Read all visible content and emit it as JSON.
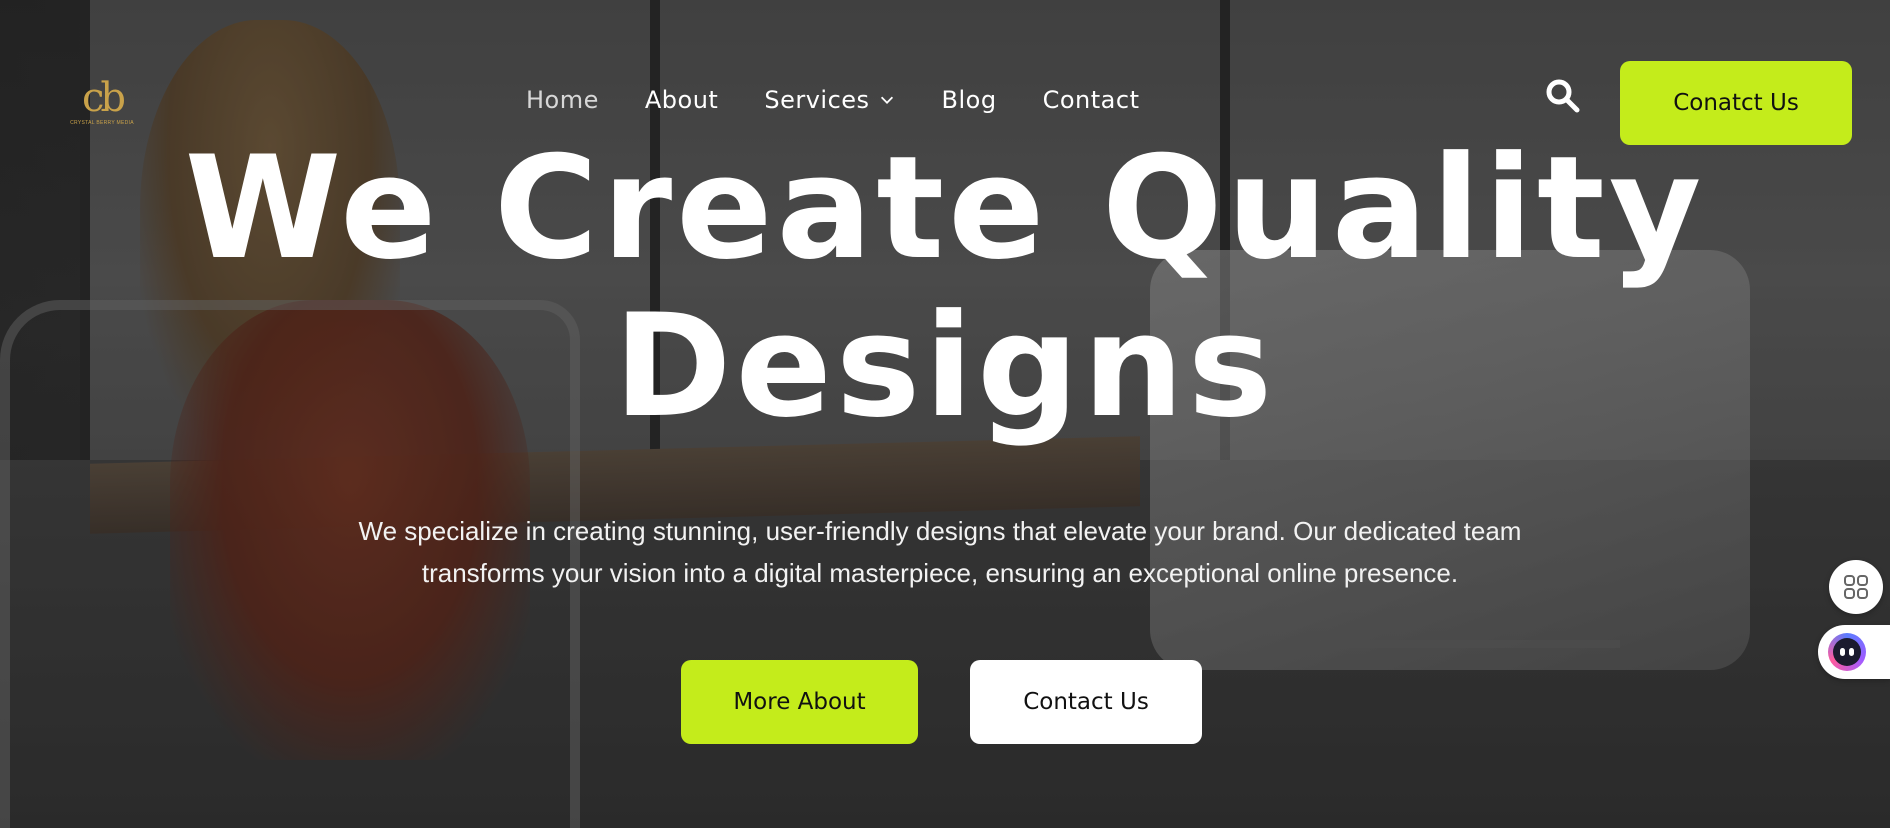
{
  "logo": {
    "mark": "cb",
    "tagline": "CRYSTAL BERRY MEDIA"
  },
  "nav": {
    "items": [
      {
        "label": "Home"
      },
      {
        "label": "About"
      },
      {
        "label": "Services"
      },
      {
        "label": "Blog"
      },
      {
        "label": "Contact"
      }
    ]
  },
  "header": {
    "cta_label": "Conatct Us"
  },
  "hero": {
    "title_line1": "We Create Quality",
    "title_line2": "Designs",
    "subtitle": "We specialize in creating stunning, user-friendly designs that elevate your brand. Our dedicated team transforms your vision into a digital masterpiece, ensuring an exceptional online presence.",
    "primary_button": "More About",
    "secondary_button": "Contact Us"
  },
  "widgets": {
    "apps_icon": "apps-grid-icon",
    "chat_icon": "chatbot-icon"
  },
  "colors": {
    "accent": "#c4ec1b",
    "text": "#ffffff",
    "logo": "#c9a24a"
  }
}
